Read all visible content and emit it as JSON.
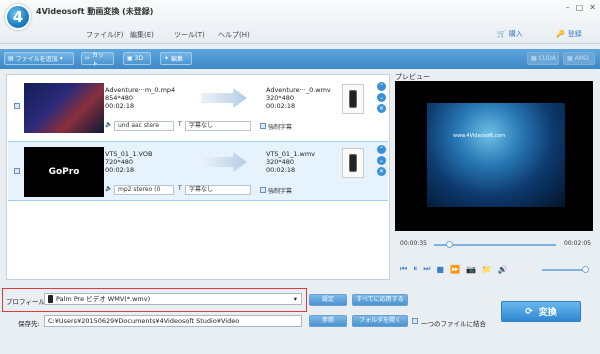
{
  "app": {
    "title": "4Videosoft 動画変換 (未登録)",
    "logo": "4"
  },
  "menu": [
    "ファイル(F)",
    "編集(E)",
    "ツール(T)",
    "ヘルプ(H)"
  ],
  "topright": {
    "buy": "購入",
    "register": "登録"
  },
  "window_controls": [
    "–",
    "□",
    "✕"
  ],
  "toolbar": {
    "add_file": "ファイルを追加",
    "cut": "カット",
    "threed": "3D",
    "edit": "編集",
    "cuda": "CUDA",
    "amd": "AMD"
  },
  "files": [
    {
      "src_name": "Adventure···m_0.mp4",
      "src_res": "854*480",
      "src_dur": "00:02:18",
      "dst_name": "Adventure···_0.wmv",
      "dst_res": "320*480",
      "dst_dur": "00:02:18",
      "audio": "und aac stere",
      "subtitle": "字幕なし",
      "forced": "強制字幕",
      "thumb_text": ""
    },
    {
      "src_name": "VTS_01_1.VOB",
      "src_res": "720*480",
      "src_dur": "00:02:18",
      "dst_name": "VTS_01_1.wmv",
      "dst_res": "320*480",
      "dst_dur": "00:02:18",
      "audio": "mp2 stereo (0",
      "subtitle": "字幕なし",
      "forced": "強制字幕",
      "thumb_text": "GoPro"
    }
  ],
  "preview": {
    "label": "プレビュー",
    "watermark": "www.4Videosoft.com",
    "time_current": "00:00:35",
    "time_total": "00:02:05"
  },
  "bottom": {
    "profile_label": "プロフィール:",
    "profile_value": "Palm Pre ビデオ WMV(*.wmv)",
    "settings": "設定",
    "apply_all": "すべてに応用する",
    "save_label": "保存先:",
    "save_path": "C:¥Users¥20150629¥Documents¥4Videosoft Studio¥Video",
    "browse": "参照",
    "open_folder": "フォルダを開く",
    "merge": "一つのファイルに結合",
    "convert": "変換"
  }
}
